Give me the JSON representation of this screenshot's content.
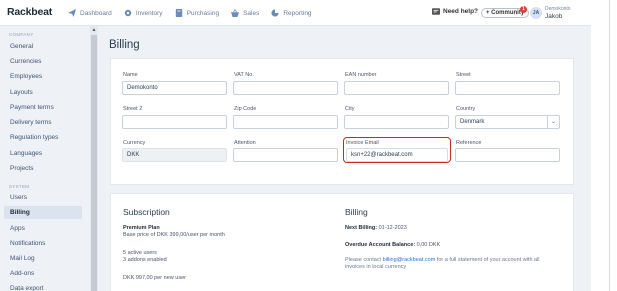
{
  "app": {
    "logo": "Rackbeat"
  },
  "nav": [
    {
      "label": "Dashboard",
      "icon": "paper-plane-icon"
    },
    {
      "label": "Inventory",
      "icon": "gear-icon"
    },
    {
      "label": "Purchasing",
      "icon": "book-icon"
    },
    {
      "label": "Sales",
      "icon": "basket-icon"
    },
    {
      "label": "Reporting",
      "icon": "pie-chart-icon"
    }
  ],
  "topbar": {
    "help": "Need help?",
    "community": "+ Community",
    "community_badge": "1",
    "avatar_initials": "JA",
    "user_company": "Demokonto",
    "user_name": "Jakob"
  },
  "sidebar": {
    "company_section": "COMPANY",
    "company_items": [
      "General",
      "Currencies",
      "Employees",
      "Layouts",
      "Payment terms",
      "Delivery terms",
      "Regulation types",
      "Languages",
      "Projects"
    ],
    "system_section": "SYSTEM",
    "system_items": [
      "Users",
      "Billing",
      "Apps",
      "Notifications",
      "Mail Log",
      "Add-ons",
      "Data export"
    ],
    "active": "Billing"
  },
  "billing": {
    "title": "Billing",
    "labels": {
      "name": "Name",
      "vat": "VAT No.",
      "ean": "EAN number",
      "street": "Street",
      "street2": "Street 2",
      "zip": "Zip Code",
      "city": "City",
      "country": "Country",
      "currency": "Currency",
      "attention": "Attention",
      "invoice_email": "Invoice Email",
      "reference": "Reference"
    },
    "values": {
      "name": "Demokonto",
      "vat": "",
      "ean": "",
      "street": "",
      "street2": "",
      "zip": "",
      "city": "",
      "country": "Denmark",
      "currency": "DKK",
      "attention": "",
      "invoice_email": "ksn+22@rackbeat.com",
      "reference": ""
    }
  },
  "subscription": {
    "title": "Subscription",
    "plan": "Premium Plan",
    "base_price": "Base price of DKK 399,00/user per month",
    "active_users": "5 active users",
    "addons": "3 addons enabled",
    "per_user": "DKK 997,00 per new user"
  },
  "billing_info": {
    "title": "Billing",
    "next_billing_label": "Next Billing:",
    "next_billing_value": "01-12-2023",
    "overdue_label": "Overdue Account Balance:",
    "overdue_value": "0,00 DKK",
    "contact_pre": "Please contact",
    "contact_email": "billing@rackbeat.com",
    "contact_post": "for a full statement of your account with all invoices in local currency"
  }
}
